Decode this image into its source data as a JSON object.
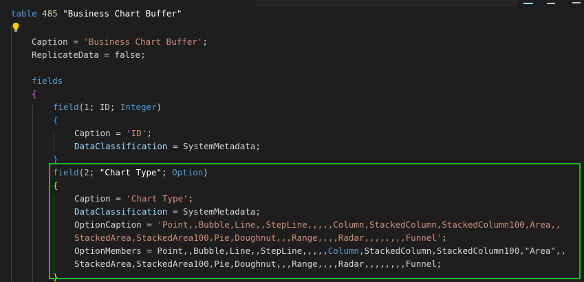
{
  "table_decl": {
    "keyword": "table",
    "id": "485",
    "name": "\"Business Chart Buffer\""
  },
  "properties": [
    {
      "name": "Caption",
      "value": "'Business Chart Buffer'"
    },
    {
      "name": "ReplicateData",
      "value": "false"
    }
  ],
  "fields_keyword": "fields",
  "fields_open": "{",
  "field1": {
    "keyword": "field",
    "id": "1",
    "name": "ID",
    "type": "Integer",
    "open": "{",
    "caption_name": "Caption",
    "caption_value": "'ID'",
    "dc_name": "DataClassification",
    "dc_value": "SystemMetadata",
    "close": "}"
  },
  "field2": {
    "keyword": "field",
    "id": "2",
    "name": "\"Chart Type\"",
    "type": "Option",
    "open": "{",
    "caption_name": "Caption",
    "caption_value": "'Chart Type'",
    "dc_name": "DataClassification",
    "dc_value": "SystemMetadata",
    "optioncaption_name": "OptionCaption",
    "optioncaption_value_line1": "'Point,,Bubble,Line,,StepLine,,,,,Column,StackedColumn,StackedColumn100,Area,,",
    "optioncaption_value_line2": "StackedArea,StackedArea100,Pie,Doughnut,,,Range,,,,Radar,,,,,,,,Funnel'",
    "optionmembers_name": "OptionMembers",
    "optionmembers_line1_part1": "Point,,Bubble,Line,,StepLine,,,,,",
    "optionmembers_line1_column": "Column",
    "optionmembers_line1_part2": ",StackedColumn,StackedColumn100,\"Area\",,",
    "optionmembers_line2": "StackedArea,StackedArea100,Pie,Doughnut,,,Range,,,,Radar,,,,,,,,Funnel;",
    "close": "}"
  },
  "ui": {
    "lightbulb": "lightbulb-icon",
    "highlight_color": "#22bb22"
  }
}
